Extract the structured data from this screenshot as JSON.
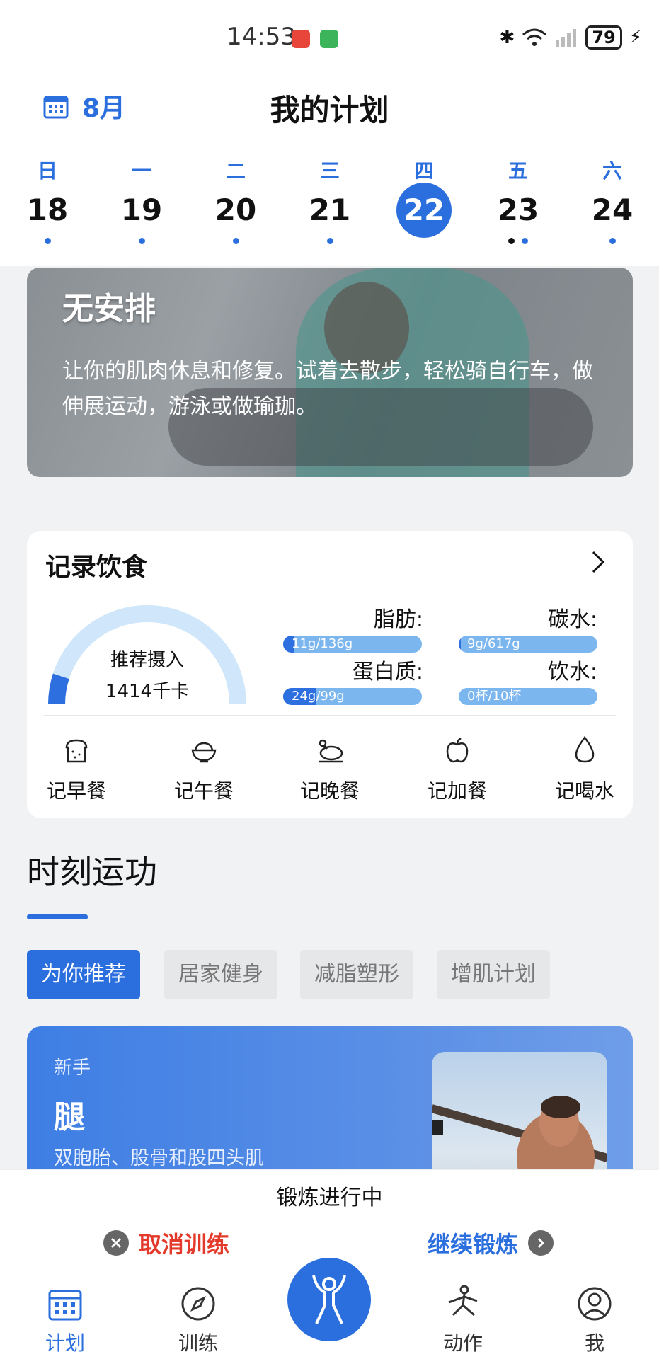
{
  "status_bar": {
    "time": "14:53",
    "battery": "79"
  },
  "header": {
    "month": "8月",
    "title": "我的计划",
    "days": [
      {
        "weekday": "日",
        "date": "18"
      },
      {
        "weekday": "一",
        "date": "19"
      },
      {
        "weekday": "二",
        "date": "20"
      },
      {
        "weekday": "三",
        "date": "21"
      },
      {
        "weekday": "四",
        "date": "22"
      },
      {
        "weekday": "五",
        "date": "23"
      },
      {
        "weekday": "六",
        "date": "24"
      }
    ]
  },
  "banner": {
    "title": "无安排",
    "text": "让你的肌肉休息和修复。试着去散步，轻松骑自行车，做伸展运动，游泳或做瑜珈。"
  },
  "diet": {
    "title": "记录饮食",
    "gauge_label": "推荐摄入",
    "gauge_value": "1414千卡",
    "gauge_progress": 0.1,
    "nutrients": [
      {
        "label": "脂肪:",
        "value": "11g/136g",
        "progress": 0.08
      },
      {
        "label": "碳水:",
        "value": "9g/617g",
        "progress": 0.015
      },
      {
        "label": "蛋白质:",
        "value": "24g/99g",
        "progress": 0.24
      },
      {
        "label": "饮水:",
        "value": "0杯/10杯",
        "progress": 0
      }
    ],
    "meals": [
      {
        "label": "记早餐",
        "icon": "bread-icon"
      },
      {
        "label": "记午餐",
        "icon": "rice-bowl-icon"
      },
      {
        "label": "记晚餐",
        "icon": "chicken-icon"
      },
      {
        "label": "记加餐",
        "icon": "apple-icon"
      },
      {
        "label": "记喝水",
        "icon": "water-drop-icon"
      }
    ]
  },
  "section": {
    "title": "时刻运功",
    "chips": [
      "为你推荐",
      "居家健身",
      "减脂塑形",
      "增肌计划"
    ]
  },
  "promo": {
    "level": "新手",
    "title": "腿",
    "subtitle": "双胞胎、股骨和股四头肌"
  },
  "workout": {
    "title": "锻炼进行中",
    "cancel": "取消训练",
    "continue": "继续锻炼"
  },
  "nav": {
    "plan": "计划",
    "train": "训练",
    "moves": "动作",
    "me": "我"
  },
  "colors": {
    "accent": "#2b6fde",
    "danger": "#e43a2b"
  }
}
